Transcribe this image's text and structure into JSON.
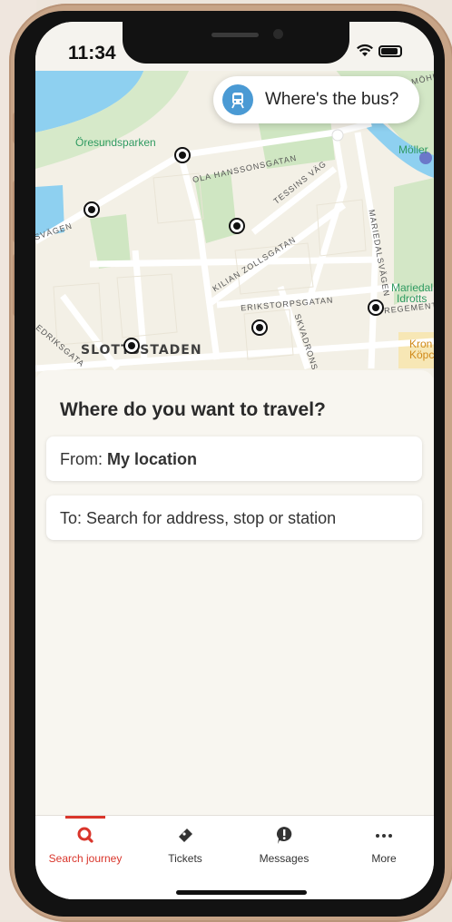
{
  "status_bar": {
    "time": "11:34"
  },
  "map": {
    "streets": [
      "OLA HANSSONSGATAN",
      "TESSINS VÄG",
      "KILIAN ZOLLSGATAN",
      "ERIKSTORPSGATAN",
      "MARIEDALSVÄGEN",
      "SKVADRONS",
      "REGEMENTS",
      "SVÄGEN",
      "EDRIKSGATA",
      "MÖHL"
    ],
    "district": "SLOTTSSTADEN",
    "places": [
      "Öresundsparken",
      "Möller",
      "Mariedal",
      "Idrotts",
      "Kron",
      "Köpc"
    ]
  },
  "bus_button": {
    "label": "Where's the bus?",
    "icon": "tram-icon"
  },
  "search": {
    "title": "Where do you want to travel?",
    "from_label": "From:",
    "from_value": "My location",
    "to_label": "To:",
    "to_placeholder": "Search for address, stop or station"
  },
  "tabs": [
    {
      "label": "Search journey",
      "icon": "search-icon",
      "active": true
    },
    {
      "label": "Tickets",
      "icon": "ticket-icon",
      "active": false
    },
    {
      "label": "Messages",
      "icon": "message-icon",
      "active": false
    },
    {
      "label": "More",
      "icon": "more-icon",
      "active": false
    }
  ],
  "colors": {
    "accent": "#d9352b",
    "map_green": "#cfe6c2",
    "map_water": "#8ed0f0",
    "bus_blue": "#4a9ad4",
    "device_frame": "#c7a487"
  }
}
